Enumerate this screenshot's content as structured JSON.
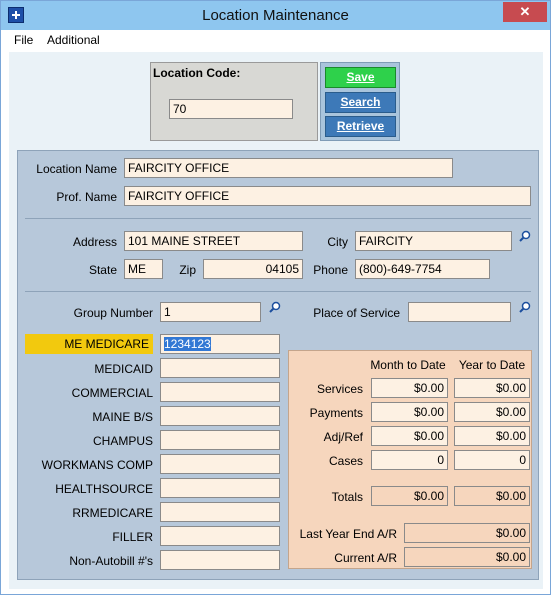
{
  "window": {
    "title": "Location Maintenance",
    "close": "✕"
  },
  "menu": {
    "file": "File",
    "additional": "Additional"
  },
  "location_code": {
    "label": "Location Code:",
    "value": "70"
  },
  "buttons": {
    "save": "Save",
    "search": "Search",
    "retrieve": "Retrieve"
  },
  "details": {
    "location_name_label": "Location Name",
    "location_name": "FAIRCITY OFFICE",
    "prof_name_label": "Prof. Name",
    "prof_name": "FAIRCITY OFFICE",
    "address_label": "Address",
    "address": "101 MAINE STREET",
    "city_label": "City",
    "city": "FAIRCITY",
    "state_label": "State",
    "state": "ME",
    "zip_label": "Zip",
    "zip": "04105",
    "phone_label": "Phone",
    "phone": "(800)-649-7754",
    "group_number_label": "Group Number",
    "group_number": "1",
    "place_of_service_label": "Place of Service",
    "place_of_service": ""
  },
  "billing_ids": [
    {
      "label": "ME MEDICARE",
      "value": "1234123"
    },
    {
      "label": "MEDICAID",
      "value": ""
    },
    {
      "label": "COMMERCIAL",
      "value": ""
    },
    {
      "label": "MAINE B/S",
      "value": ""
    },
    {
      "label": "CHAMPUS",
      "value": ""
    },
    {
      "label": "WORKMANS COMP",
      "value": ""
    },
    {
      "label": "HEALTHSOURCE",
      "value": ""
    },
    {
      "label": "RRMEDICARE",
      "value": ""
    },
    {
      "label": "FILLER",
      "value": ""
    },
    {
      "label": "Non-Autobill #'s",
      "value": ""
    }
  ],
  "totals": {
    "month_to_date": "Month to Date",
    "year_to_date": "Year to Date",
    "rows": [
      {
        "label": "Services",
        "mtd": "$0.00",
        "ytd": "$0.00"
      },
      {
        "label": "Payments",
        "mtd": "$0.00",
        "ytd": "$0.00"
      },
      {
        "label": "Adj/Ref",
        "mtd": "$0.00",
        "ytd": "$0.00"
      },
      {
        "label": "Cases",
        "mtd": "0",
        "ytd": "0"
      }
    ],
    "totals_label": "Totals",
    "totals_mtd": "$0.00",
    "totals_ytd": "$0.00",
    "last_year_end_label": "Last Year End A/R",
    "last_year_end": "$0.00",
    "current_ar_label": "Current A/R",
    "current_ar": "$0.00"
  },
  "colors": {
    "titlebar": "#8ec6ef",
    "panel": "#b7c8da",
    "highlight": "#f2c90e",
    "save_button": "#2ed14b"
  }
}
